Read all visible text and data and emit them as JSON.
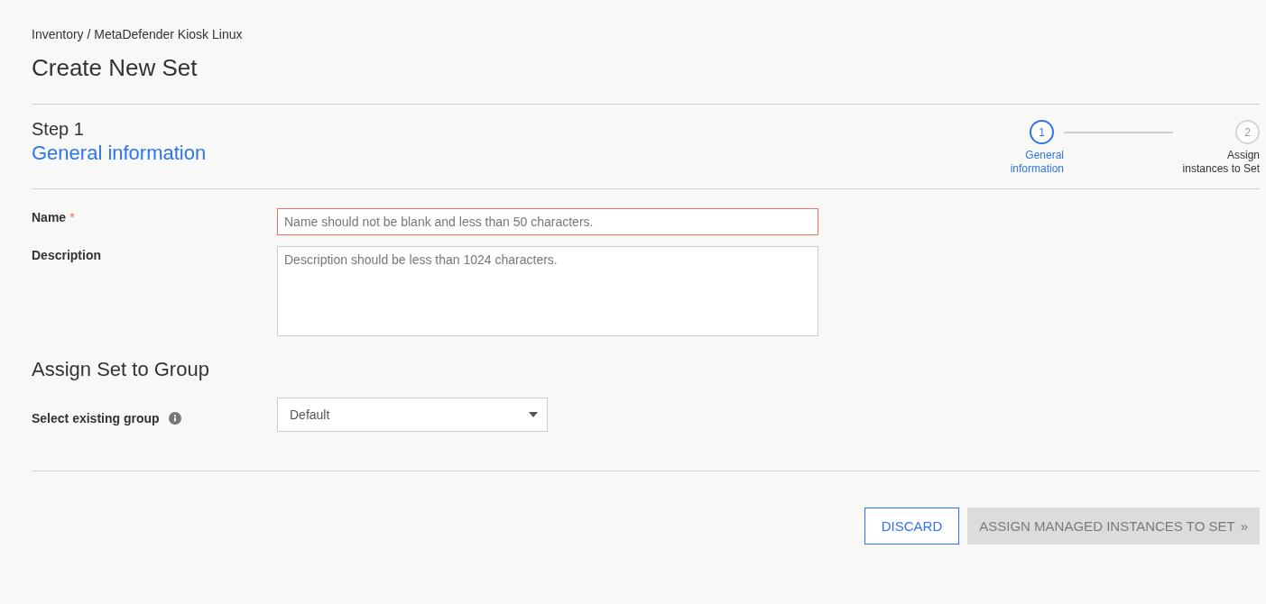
{
  "breadcrumb": "Inventory / MetaDefender Kiosk Linux",
  "title": "Create New Set",
  "step": {
    "label": "Step 1",
    "name": "General information"
  },
  "stepper": [
    {
      "number": "1",
      "label": "General information",
      "selected": true
    },
    {
      "number": "2",
      "label": "Assign instances to Set",
      "selected": false
    }
  ],
  "fields": [
    {
      "kind": "input",
      "label": "Name",
      "required_mark": "*",
      "placeholder": "Name should not be blank and less than 50 characters.",
      "error": true
    },
    {
      "kind": "textarea",
      "label": "Description",
      "placeholder": "Description should be less than 1024 characters.",
      "error": false
    }
  ],
  "group_section": {
    "title": "Assign Set to Group",
    "label": "Select existing group",
    "value": "Default"
  },
  "buttons": [
    {
      "label": "DISCARD",
      "disabled": false,
      "kind": "outline"
    },
    {
      "label": "ASSIGN MANAGED INSTANCES TO SET",
      "icon": "»",
      "disabled": true,
      "kind": "primary"
    }
  ]
}
